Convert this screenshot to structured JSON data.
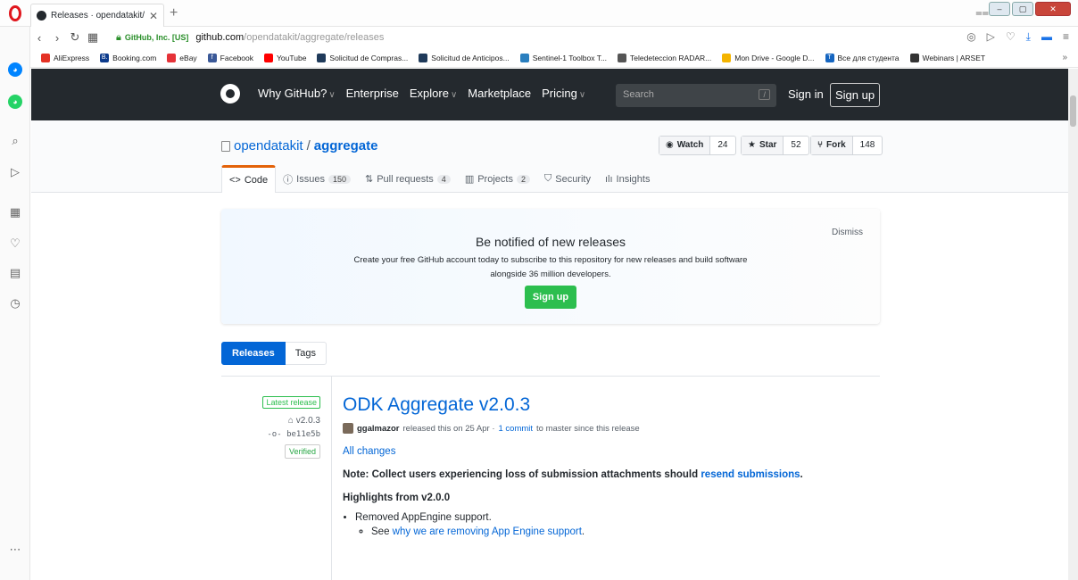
{
  "browser": {
    "tab_title": "Releases · opendatakit/aggre",
    "org": "GitHub, Inc. [US]",
    "url_host": "github.com",
    "url_path": "/opendatakit/aggregate/releases",
    "bookmarks": [
      {
        "label": "AliExpress",
        "color": "#e43225"
      },
      {
        "label": "Booking.com",
        "color": "#0c3b8c",
        "glyph": "B."
      },
      {
        "label": "eBay",
        "color": "#e53238"
      },
      {
        "label": "Facebook",
        "color": "#3b5998",
        "glyph": "f"
      },
      {
        "label": "YouTube",
        "color": "#ff0000"
      },
      {
        "label": "Solicitud de Compras...",
        "color": "#1f3a5a"
      },
      {
        "label": "Solicitud de Anticipos...",
        "color": "#1f3a5a"
      },
      {
        "label": "Sentinel-1 Toolbox T...",
        "color": "#2a7fbf"
      },
      {
        "label": "Teledeteccion RADAR...",
        "color": "#555555"
      },
      {
        "label": "Mon Drive - Google D...",
        "color": "#f4b400"
      },
      {
        "label": "Все для студента",
        "color": "#1565c0",
        "glyph": "T"
      },
      {
        "label": "Webinars | ARSET",
        "color": "#333333"
      }
    ],
    "bookmarks_more": "»"
  },
  "header": {
    "nav": [
      {
        "label": "Why GitHub?",
        "dropdown": true
      },
      {
        "label": "Enterprise",
        "dropdown": false
      },
      {
        "label": "Explore",
        "dropdown": true
      },
      {
        "label": "Marketplace",
        "dropdown": false
      },
      {
        "label": "Pricing",
        "dropdown": true
      }
    ],
    "search_placeholder": "Search",
    "search_key": "/",
    "signin": "Sign in",
    "signup": "Sign up"
  },
  "repo": {
    "owner": "opendatakit",
    "separator": "/",
    "name": "aggregate",
    "watch": {
      "label": "Watch",
      "count": "24"
    },
    "star": {
      "label": "Star",
      "count": "52"
    },
    "fork": {
      "label": "Fork",
      "count": "148"
    },
    "tabs": [
      {
        "label": "Code",
        "count": "",
        "icon": "<>"
      },
      {
        "label": "Issues",
        "count": "150",
        "icon": "ⓘ"
      },
      {
        "label": "Pull requests",
        "count": "4",
        "icon": "⇅"
      },
      {
        "label": "Projects",
        "count": "2",
        "icon": "▥"
      },
      {
        "label": "Security",
        "count": "",
        "icon": "⛉"
      },
      {
        "label": "Insights",
        "count": "",
        "icon": "ılı"
      }
    ]
  },
  "notify": {
    "title": "Be notified of new releases",
    "description": "Create your free GitHub account today to subscribe to this repository for new releases and build software alongside 36 million developers.",
    "dismiss": "Dismiss",
    "signup": "Sign up"
  },
  "subnav": {
    "releases": "Releases",
    "tags": "Tags"
  },
  "release": {
    "latest": "Latest release",
    "tag": "v2.0.3",
    "commit": "be11e5b",
    "verified": "Verified",
    "title": "ODK Aggregate v2.0.3",
    "author": "ggalmazor",
    "byline_mid": "released this on 25 Apr ·",
    "commits_link": "1 commit",
    "byline_end": "to master since this release",
    "all_changes": "All changes",
    "note_prefix": "Note: Collect users experiencing loss of submission attachments should",
    "note_link": "resend submissions",
    "note_end": ".",
    "highlights": "Highlights from v2.0.0",
    "bullet1": "Removed AppEngine support.",
    "sub_prefix": "See",
    "sub_link": "why we are removing App Engine support",
    "sub_end": "."
  }
}
